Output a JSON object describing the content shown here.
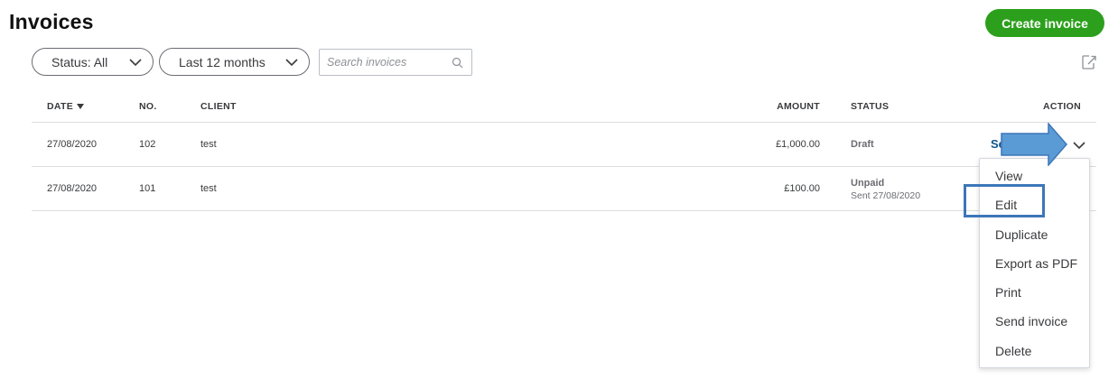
{
  "header": {
    "title": "Invoices",
    "create_button_label": "Create invoice"
  },
  "filters": {
    "status_label": "Status: All",
    "date_range_label": "Last 12 months",
    "search_placeholder": "Search invoices"
  },
  "table": {
    "columns": {
      "date": "DATE",
      "no": "NO.",
      "client": "CLIENT",
      "amount": "AMOUNT",
      "status": "STATUS",
      "action": "ACTION"
    },
    "rows": [
      {
        "date": "27/08/2020",
        "no": "102",
        "client": "test",
        "amount": "£1,000.00",
        "status": "Draft",
        "action_label": "Se"
      },
      {
        "date": "27/08/2020",
        "no": "101",
        "client": "test",
        "amount": "£100.00",
        "status": "Unpaid",
        "status_sub": "Sent 27/08/2020"
      }
    ]
  },
  "action_menu": {
    "items": [
      {
        "label": "View"
      },
      {
        "label": "Edit"
      },
      {
        "label": "Duplicate"
      },
      {
        "label": "Export as PDF"
      },
      {
        "label": "Print"
      },
      {
        "label": "Send invoice"
      },
      {
        "label": "Delete"
      }
    ]
  },
  "colors": {
    "primary_green": "#2ca01c",
    "link_blue": "#0d5489",
    "annotation_blue": "#3d76b9",
    "arrow_fill": "#5b9bd5"
  },
  "icons": {
    "status_chevron": "chevron-down-icon",
    "range_chevron": "chevron-down-icon",
    "search": "search-icon",
    "export": "export-icon",
    "sort": "sort-down-icon",
    "annotation": "arrow-right-icon"
  }
}
